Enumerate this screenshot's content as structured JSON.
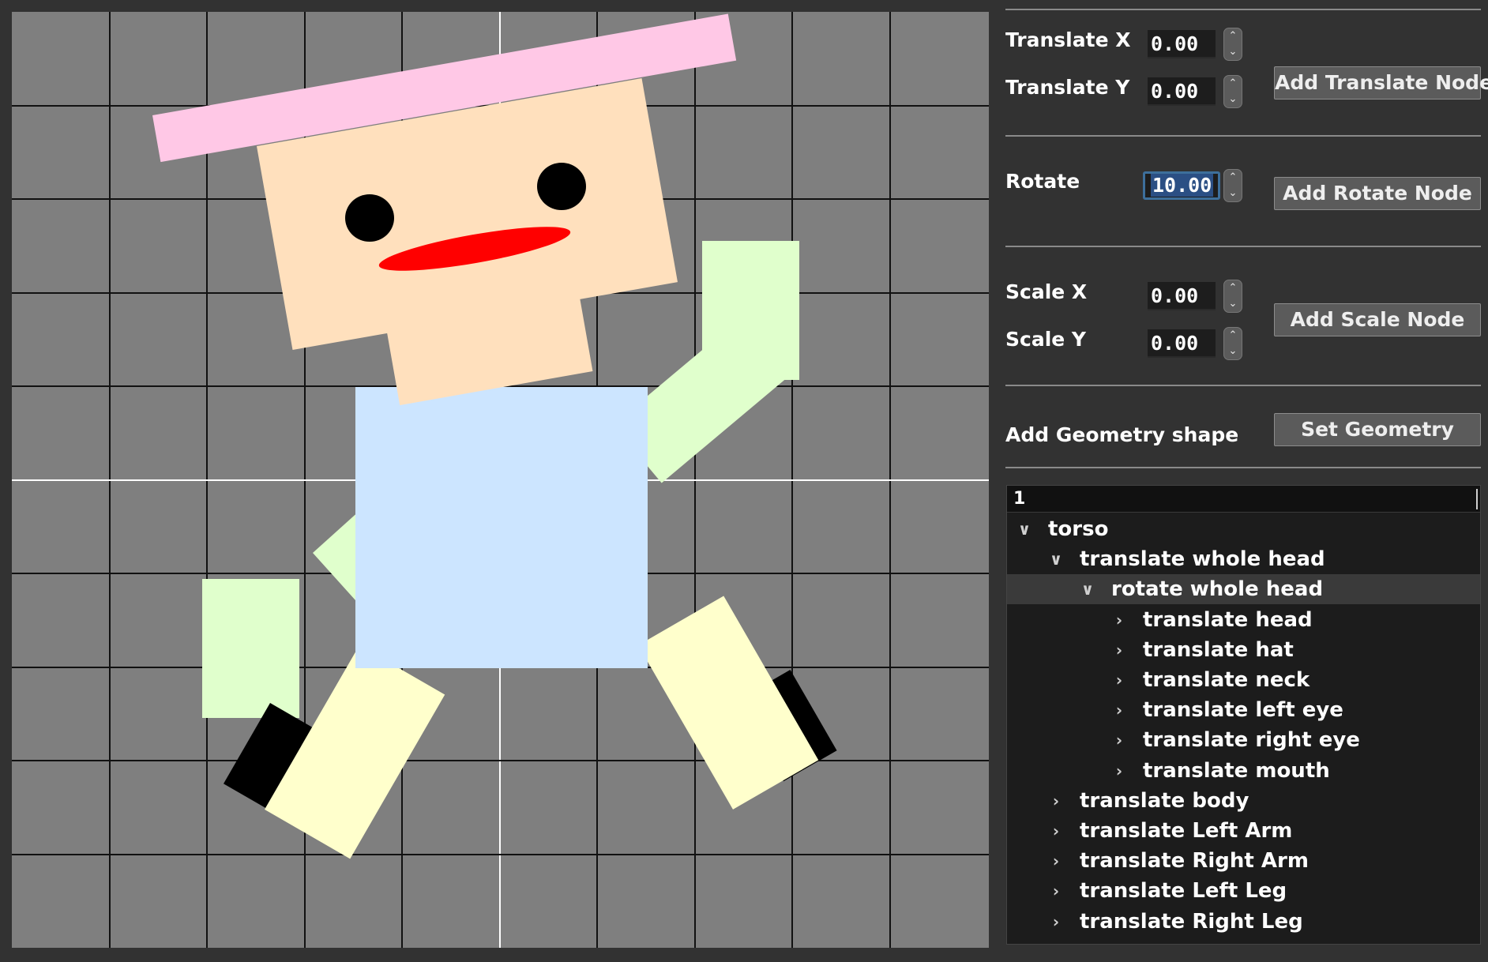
{
  "scene": {
    "background_color": "#7f7f7f",
    "grid_line_color": "#111111",
    "axis_color": "#ffffff",
    "colors": {
      "hat": "#ffc8e6",
      "head": "#ffe0bd",
      "neck": "#ffe0bd",
      "eyes": "#000000",
      "mouth": "#ff0000",
      "body": "#cce5ff",
      "arms": "#e0ffcc",
      "legs": "#ffffcc",
      "shoes": "#000000"
    }
  },
  "controls": {
    "translate_x_label": "Translate X",
    "translate_x_value": "0.00",
    "translate_y_label": "Translate Y",
    "translate_y_value": "0.00",
    "add_translate_label": "Add Translate Node",
    "rotate_label": "Rotate",
    "rotate_value": "10.00",
    "add_rotate_label": "Add Rotate Node",
    "scale_x_label": "Scale X",
    "scale_x_value": "0.00",
    "scale_y_label": "Scale Y",
    "scale_y_value": "0.00",
    "add_scale_label": "Add Scale Node",
    "geometry_label": "Add Geometry shape",
    "set_geometry_label": "Set Geometry"
  },
  "tree": {
    "header": "1",
    "rows": [
      {
        "label": "torso",
        "expanded": true
      },
      {
        "label": "translate whole head",
        "expanded": true
      },
      {
        "label": "rotate whole head",
        "expanded": true,
        "selected": true
      },
      {
        "label": "translate head",
        "expanded": false
      },
      {
        "label": "translate hat",
        "expanded": false
      },
      {
        "label": "translate neck",
        "expanded": false
      },
      {
        "label": "translate left eye",
        "expanded": false
      },
      {
        "label": "translate right eye",
        "expanded": false
      },
      {
        "label": "translate mouth",
        "expanded": false
      },
      {
        "label": "translate body",
        "expanded": false
      },
      {
        "label": "translate Left Arm",
        "expanded": false
      },
      {
        "label": "translate Right Arm",
        "expanded": false
      },
      {
        "label": "translate Left Leg",
        "expanded": false
      },
      {
        "label": "translate Right Leg",
        "expanded": false
      }
    ]
  },
  "icons": {
    "expanded": "chevron-down-icon",
    "collapsed": "chevron-right-icon",
    "spin_up": "arrow-up-icon",
    "spin_down": "arrow-down-icon"
  }
}
